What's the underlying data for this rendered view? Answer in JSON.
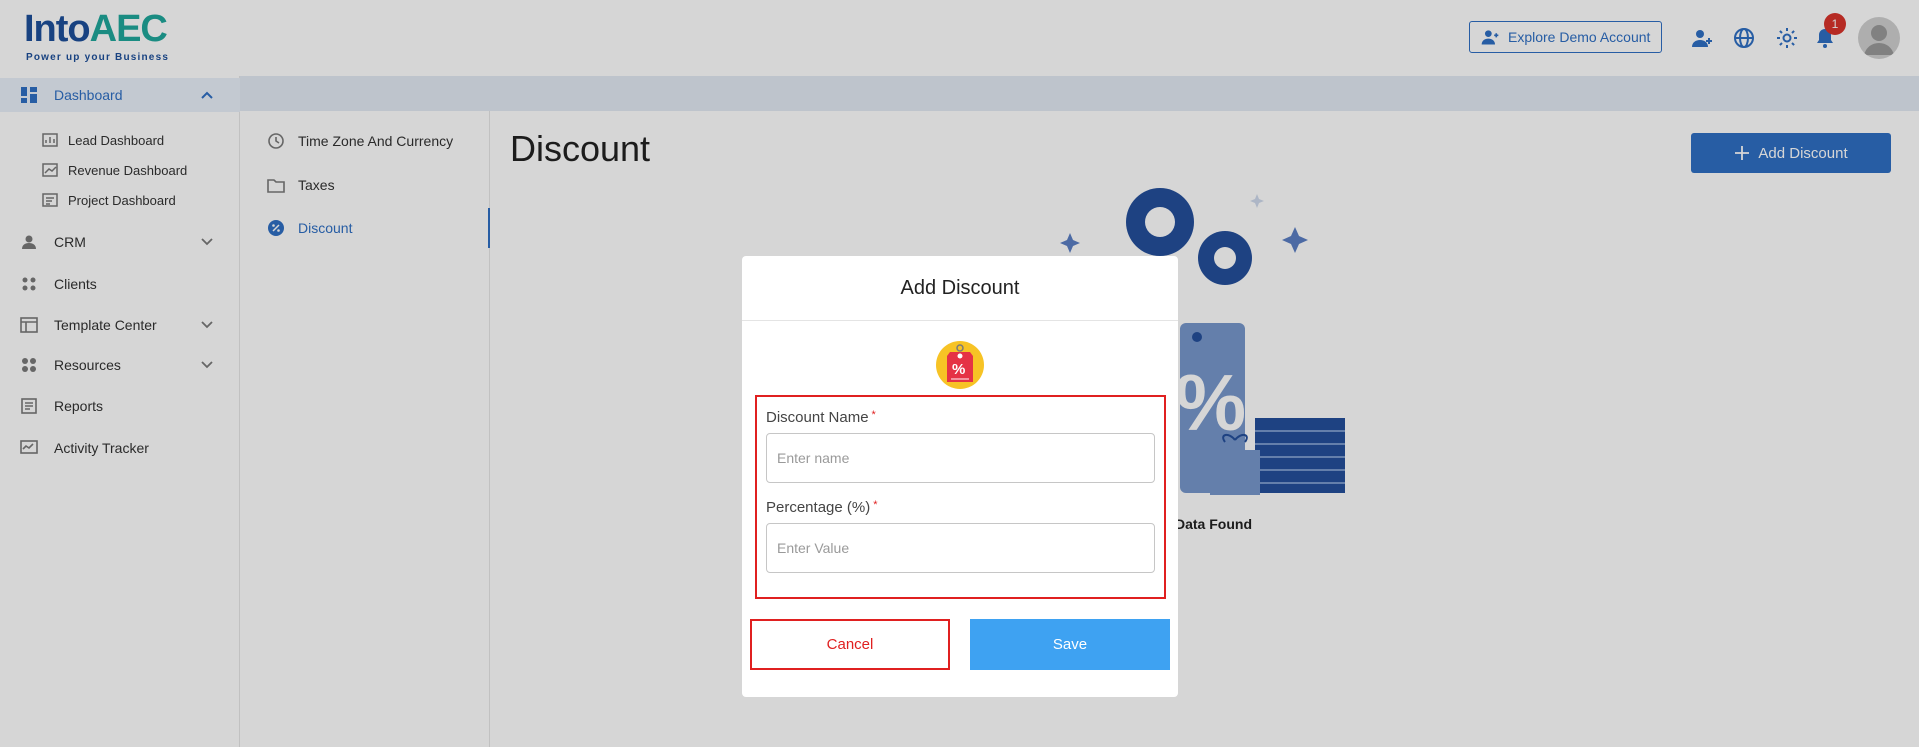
{
  "brand": {
    "name_main": "Into",
    "name_accent": "AEC",
    "tagline": "Power up your Business"
  },
  "header": {
    "explore_label": "Explore Demo Account",
    "notification_count": "1",
    "icons": [
      "add-user-icon",
      "globe-icon",
      "gear-icon",
      "bell-icon",
      "avatar"
    ]
  },
  "sidebar": {
    "items": [
      {
        "label": "Dashboard",
        "icon": "dashboard-icon",
        "expanded": true
      },
      {
        "label": "CRM",
        "icon": "crm-icon"
      },
      {
        "label": "Clients",
        "icon": "clients-icon"
      },
      {
        "label": "Template Center",
        "icon": "template-icon"
      },
      {
        "label": "Resources",
        "icon": "resources-icon"
      },
      {
        "label": "Reports",
        "icon": "reports-icon"
      },
      {
        "label": "Activity Tracker",
        "icon": "activity-icon"
      }
    ],
    "dashboard_sub": [
      {
        "label": "Lead Dashboard"
      },
      {
        "label": "Revenue Dashboard"
      },
      {
        "label": "Project Dashboard"
      }
    ]
  },
  "settings_nav": {
    "items": [
      {
        "label": "Time Zone And Currency"
      },
      {
        "label": "Taxes"
      },
      {
        "label": "Discount",
        "active": true
      }
    ]
  },
  "main": {
    "title": "Discount",
    "add_label": "Add Discount",
    "empty_text": "Data Found"
  },
  "modal": {
    "title": "Add Discount",
    "fields": [
      {
        "label": "Discount Name",
        "placeholder": "Enter name",
        "value": ""
      },
      {
        "label": "Percentage (%)",
        "placeholder": "Enter Value",
        "value": ""
      }
    ],
    "required_mark": "*",
    "cancel_label": "Cancel",
    "save_label": "Save"
  },
  "colors": {
    "primary": "#2f6fc4",
    "save": "#3ea2f2",
    "danger": "#e02020"
  }
}
